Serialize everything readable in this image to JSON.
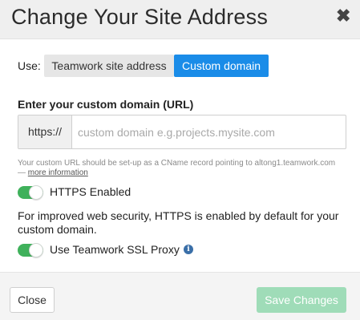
{
  "dialog": {
    "title": "Change Your Site Address",
    "close_icon": "close-icon"
  },
  "use": {
    "label": "Use:",
    "options": [
      "Teamwork site address",
      "Custom domain"
    ],
    "selected": "Custom domain"
  },
  "domain": {
    "label": "Enter your custom domain (URL)",
    "prefix": "https://",
    "value": "",
    "placeholder": "custom domain e.g.projects.mysite.com",
    "hint": "Your custom URL should be set-up as a CName record pointing to altong1.teamwork.com —",
    "hint_link": "more information"
  },
  "https": {
    "label": "HTTPS Enabled",
    "enabled": true,
    "description": "For improved web security, HTTPS is enabled by default for your custom domain."
  },
  "ssl_proxy": {
    "label": "Use Teamwork SSL Proxy",
    "enabled": true,
    "info_icon": "info-icon"
  },
  "footer": {
    "close_label": "Close",
    "save_label": "Save Changes"
  },
  "colors": {
    "accent": "#1a8ce8",
    "toggle_on": "#3fb15b",
    "save_disabled": "#9fdcb8",
    "info": "#3a6fa8"
  }
}
